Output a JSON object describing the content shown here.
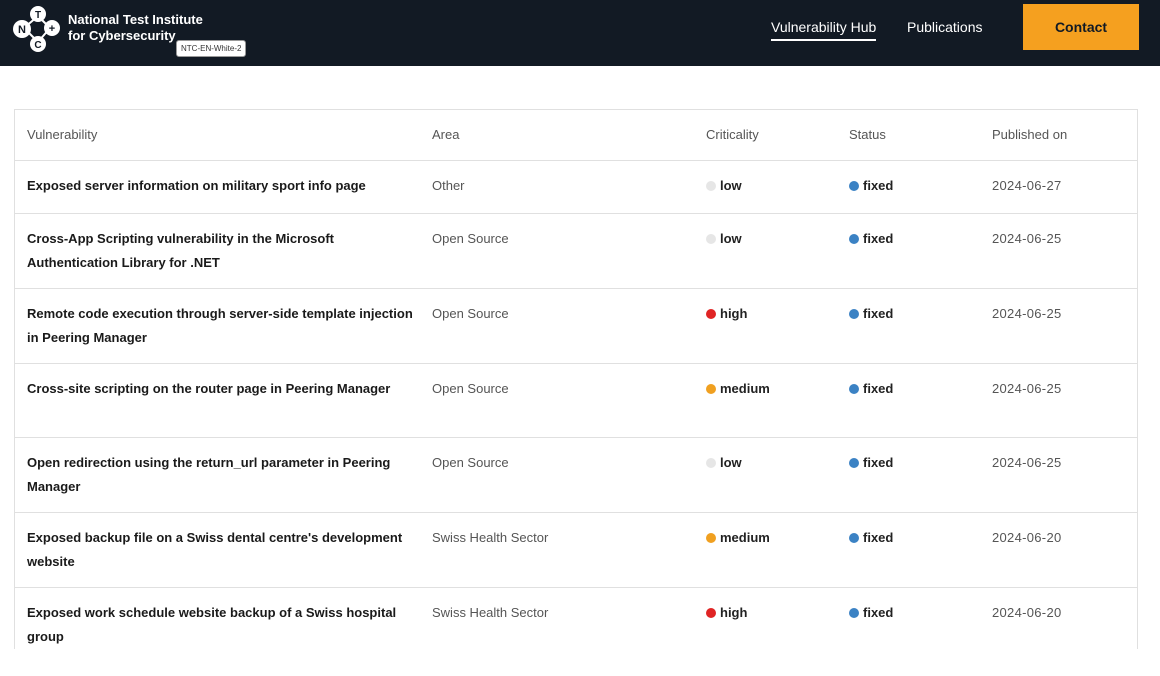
{
  "header": {
    "logo_letters": [
      "N",
      "T",
      "C",
      "+"
    ],
    "brand_line1": "National Test Institute",
    "brand_line2": "for Cybersecurity",
    "badge": "NTC-EN-White-2",
    "nav": [
      {
        "label": "Vulnerability Hub",
        "active": true
      },
      {
        "label": "Publications",
        "active": false
      }
    ],
    "contact_label": "Contact"
  },
  "table": {
    "headers": [
      "Vulnerability",
      "Area",
      "Criticality",
      "Status",
      "Published on"
    ],
    "rows": [
      {
        "title": "Exposed server information on military sport info page",
        "area": "Other",
        "criticality": "low",
        "status": "fixed",
        "date": "2024-06-27"
      },
      {
        "title": "Cross-App Scripting vulnerability in the Microsoft Authentication Library for .NET",
        "area": "Open Source",
        "criticality": "low",
        "status": "fixed",
        "date": "2024-06-25"
      },
      {
        "title": "Remote code execution through server-side template injection in Peering Manager",
        "area": "Open Source",
        "criticality": "high",
        "status": "fixed",
        "date": "2024-06-25"
      },
      {
        "title": "Cross-site scripting on the router page in Peering Manager",
        "area": "Open Source",
        "criticality": "medium",
        "status": "fixed",
        "date": "2024-06-25"
      },
      {
        "title": "Open redirection using the return_url parameter in Peering Manager",
        "area": "Open Source",
        "criticality": "low",
        "status": "fixed",
        "date": "2024-06-25"
      },
      {
        "title": "Exposed backup file on a Swiss dental centre's development website",
        "area": "Swiss Health Sector",
        "criticality": "medium",
        "status": "fixed",
        "date": "2024-06-20"
      },
      {
        "title": "Exposed work schedule website backup of a Swiss hospital group",
        "area": "Swiss Health Sector",
        "criticality": "high",
        "status": "fixed",
        "date": "2024-06-20"
      }
    ]
  },
  "colors": {
    "header_bg": "#121a24",
    "accent": "#f5a01f",
    "low": "#e6e6e6",
    "medium": "#f0a020",
    "high": "#e02424",
    "fixed": "#3b82c4"
  }
}
